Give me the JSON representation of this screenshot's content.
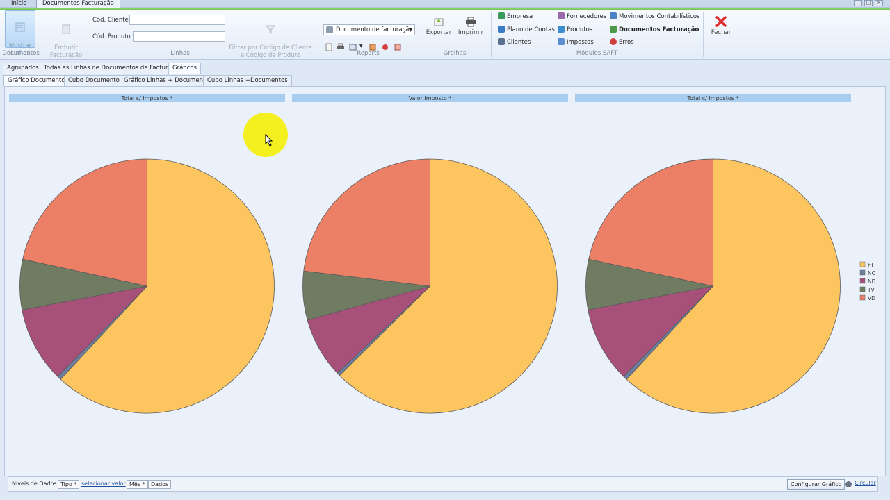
{
  "app_tabs": [
    {
      "label": "Início"
    },
    {
      "label": "Documentos Facturação"
    }
  ],
  "ribbon": {
    "documentos": {
      "group_label": "Documentos",
      "mostrar_linhas": "Mostrar\nLinhas"
    },
    "linhas": {
      "group_label": "Linhas",
      "embutir": "Embutir\nFacturação",
      "cod_cliente_label": "Cód. Cliente",
      "cod_cliente_value": "",
      "cod_produto_label": "Cód. Produto",
      "cod_produto_value": "",
      "filtrar": "Filtrar por Código de Cliente\ne Código de Produto"
    },
    "reports": {
      "group_label": "Reports",
      "select_value": "Documento de facturaçã"
    },
    "grelhas": {
      "group_label": "Grelhas",
      "exportar": "Exportar",
      "imprimir": "Imprimir"
    },
    "saft": {
      "group_label": "Módulos SAFT",
      "items": [
        {
          "label": "Empresa",
          "color": "#3a9a5b",
          "bold": false
        },
        {
          "label": "Plano de Contas",
          "color": "#3b7bc8",
          "bold": false
        },
        {
          "label": "Clientes",
          "color": "#5b6f8e",
          "bold": false
        },
        {
          "label": "Fornecedores",
          "color": "#9a6aa8",
          "bold": false
        },
        {
          "label": "Produtos",
          "color": "#3c8fcf",
          "bold": false
        },
        {
          "label": "Impostos",
          "color": "#5a8ed1",
          "bold": false
        },
        {
          "label": "Movimentos Contabilísticos",
          "color": "#4a82c4",
          "bold": false
        },
        {
          "label": "Documentos Facturação",
          "color": "#4a9a48",
          "bold": true
        },
        {
          "label": "Erros",
          "color": "#d04040",
          "bold": false
        }
      ]
    },
    "fechar": "Fechar"
  },
  "tabs_level1": [
    {
      "label": "Agrupados",
      "active": false
    },
    {
      "label": "Todas as Linhas de Documentos de Facturação",
      "active": false
    },
    {
      "label": "Gráficos",
      "active": true
    }
  ],
  "tabs_level2": [
    {
      "label": "Gráfico Documentos",
      "active": true
    },
    {
      "label": "Cubo Documentos",
      "active": false
    },
    {
      "label": "Gráfico Linhas + Documentos",
      "active": false
    },
    {
      "label": "Cubo Linhas +Documentos",
      "active": false
    }
  ],
  "chart_data": {
    "type": "pie",
    "categories": [
      "FT",
      "NC",
      "ND",
      "TV",
      "VD"
    ],
    "colors": [
      "#fdc560",
      "#6b7fa0",
      "#a7507a",
      "#6f7c62",
      "#ec8066"
    ],
    "legend_position": "right",
    "charts": [
      {
        "title": "Total s/ Impostos *",
        "values": [
          61.9,
          0.5,
          9.6,
          6.4,
          21.6
        ]
      },
      {
        "title": "Valor Imposto *",
        "values": [
          62.6,
          0.4,
          7.7,
          6.2,
          23.1
        ]
      },
      {
        "title": "Total c/ Impostos *",
        "values": [
          61.9,
          0.5,
          9.6,
          6.4,
          21.6
        ]
      }
    ]
  },
  "bottom_bar": {
    "niveis_label": "Níveis de Dados:",
    "tipo": "Tipo *",
    "selecionar": "selecionar valor",
    "mes": "Mês *",
    "dados": "Dados",
    "config_button": "Configurar Gráfico",
    "circular": "Circular"
  }
}
